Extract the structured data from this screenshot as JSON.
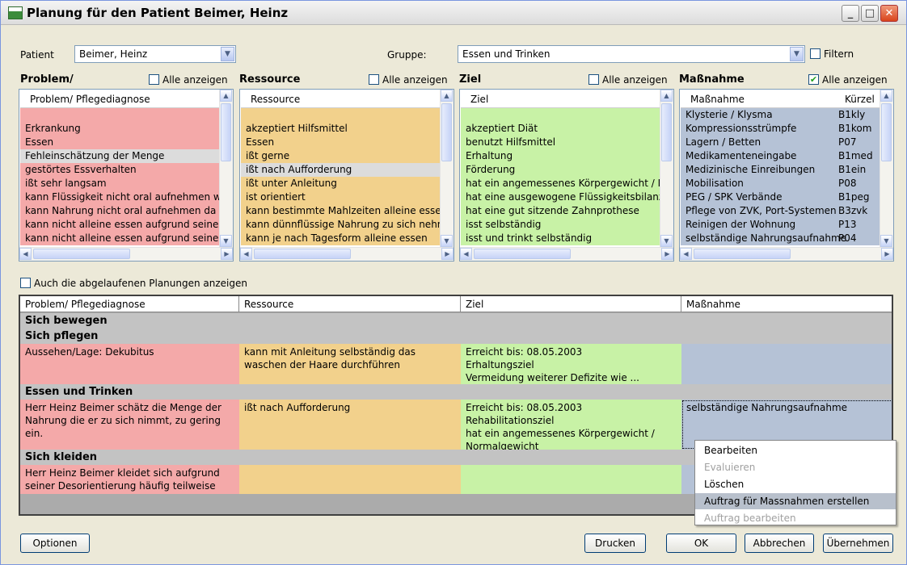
{
  "window": {
    "title": "Planung für den Patient Beimer, Heinz"
  },
  "patient": {
    "label": "Patient",
    "value": "Beimer, Heinz"
  },
  "gruppe": {
    "label": "Gruppe:",
    "value": "Essen und Trinken"
  },
  "filtern": {
    "label": "Filtern",
    "checked": false
  },
  "lists": [
    {
      "section": "Problem/",
      "show_all_label": "Alle anzeigen",
      "show_all": false,
      "header": "Problem/ Pflegediagnose",
      "color": "#f4a9a9",
      "items": [
        "",
        "Erkrankung",
        "Essen",
        "Fehleinschätzung der Menge",
        "gestörtes Essverhalten",
        "ißt sehr langsam",
        "kann Flüssigkeit nicht oral aufnehmen weil",
        "kann Nahrung nicht oral aufnehmen da",
        "kann nicht alleine essen aufgrund seiner",
        "kann nicht alleine essen aufgrund seiner E"
      ],
      "selected": 3
    },
    {
      "section": "Ressource",
      "show_all_label": "Alle anzeigen",
      "show_all": false,
      "header": "Ressource",
      "color": "#f2d18c",
      "items": [
        "",
        "akzeptiert Hilfsmittel",
        "Essen",
        "ißt gerne",
        "ißt nach Aufforderung",
        "ißt unter Anleitung",
        "ist orientiert",
        "kann bestimmte Mahlzeiten alleine essen",
        "kann dünnflüssige Nahrung zu sich nehme",
        "kann je nach Tagesform alleine essen"
      ],
      "selected": 4
    },
    {
      "section": "Ziel",
      "show_all_label": "Alle anzeigen",
      "show_all": false,
      "header": "Ziel",
      "color": "#c8f2a6",
      "items": [
        "",
        "akzeptiert Diät",
        "benutzt Hilfsmittel",
        "Erhaltung",
        "Förderung",
        "hat ein angemessenes Körpergewicht / No",
        "hat eine ausgewogene Flüssigkeitsbilanz",
        "hat eine gut sitzende Zahnprothese",
        "isst selbständig",
        "isst und trinkt selbständig"
      ],
      "selected": -1
    },
    {
      "section": "Maßnahme",
      "show_all_label": "Alle anzeigen",
      "show_all": true,
      "header": "Maßnahme",
      "header2": "Kürzel",
      "color": "#b5c2d6",
      "items": [
        [
          "Klysterie / Klysma",
          "B1kly"
        ],
        [
          "Kompressionsstrümpfe",
          "B1kom"
        ],
        [
          "Lagern / Betten",
          "P07"
        ],
        [
          "Medikamenteneingabe",
          "B1med"
        ],
        [
          "Medizinische Einreibungen",
          "B1ein"
        ],
        [
          "Mobilisation",
          "P08"
        ],
        [
          "PEG / SPK Verbände",
          "B1peg"
        ],
        [
          "Pflege von ZVK, Port-Systemen",
          "B3zvk"
        ],
        [
          "Reinigen der Wohnung",
          "P13"
        ],
        [
          "selbständige Nahrungsaufnahme",
          "P04"
        ]
      ],
      "selected": -1
    }
  ],
  "expired": {
    "label": "Auch die abgelaufenen Planungen anzeigen",
    "checked": false
  },
  "grid": {
    "columns": [
      "Problem/ Pflegediagnose",
      "Ressource",
      "Ziel",
      "Maßnahme"
    ],
    "groups": [
      {
        "name": "Sich bewegen",
        "rows": []
      },
      {
        "name": "Sich pflegen",
        "rows": [
          {
            "problem": "Aussehen/Lage: Dekubitus",
            "ressource": "kann mit Anleitung selbständig das waschen der Haare durchführen",
            "ziel": "Erreicht bis: 08.05.2003\nErhaltungsziel\nVermeidung weiterer Defizite wie ...",
            "massnahme": ""
          }
        ]
      },
      {
        "name": "Essen und Trinken",
        "rows": [
          {
            "problem": "Herr Heinz Beimer schätz die Menge der Nahrung die er zu sich nimmt, zu gering ein.",
            "ressource": "ißt nach Aufforderung",
            "ziel": "Erreicht bis: 08.05.2003\nRehabilitationsziel\nhat ein angemessenes Körpergewicht / Normalgewicht",
            "massnahme": "selbständige Nahrungsaufnahme"
          }
        ]
      },
      {
        "name": "Sich kleiden",
        "rows": [
          {
            "problem": "Herr Heinz Beimer kleidet sich aufgrund  seiner Desorientierung häufig teilweise aus.",
            "ressource": "",
            "ziel": "",
            "massnahme": ""
          }
        ]
      }
    ]
  },
  "context_menu": {
    "items": [
      {
        "label": "Bearbeiten",
        "enabled": true
      },
      {
        "label": "Evaluieren",
        "enabled": false
      },
      {
        "label": "Löschen",
        "enabled": true
      },
      {
        "label": "Auftrag für Massnahmen erstellen",
        "enabled": true,
        "highlighted": true
      },
      {
        "label": "Auftrag bearbeiten",
        "enabled": false
      }
    ]
  },
  "buttons": {
    "optionen": "Optionen",
    "drucken": "Drucken",
    "ok": "OK",
    "abbrechen": "Abbrechen",
    "uebernehmen": "Übernehmen"
  },
  "colors": {
    "problem": "#f4a9a9",
    "ressource": "#f2d18c",
    "ziel": "#c8f2a6",
    "massnahme": "#b5c2d6",
    "group_bg": "#c3c3c3"
  }
}
